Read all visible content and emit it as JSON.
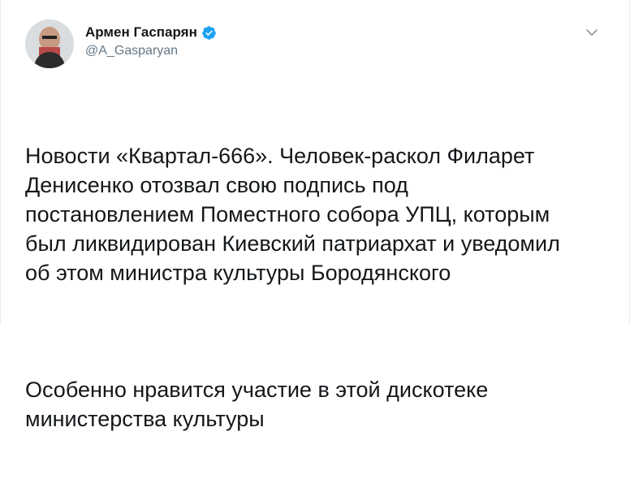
{
  "author": {
    "display_name": "Армен Гаспарян",
    "handle": "@A_Gasparyan",
    "verified": true,
    "avatar_icon": "user-avatar"
  },
  "menu": {
    "icon": "chevron-down-icon"
  },
  "tweet": {
    "paragraph_1": "Новости «Квартал-666». Человек-раскол Филарет\nДенисенко отозвал свою подпись под\nпостановлением Поместного собора УПЦ, которым\nбыл ликвидирован Киевский патриархат и уведомил\nоб этом министра культуры Бородянского",
    "paragraph_2": "Особенно нравится участие в этой дискотеке\nминистерства культуры"
  },
  "colors": {
    "text": "#14171a",
    "secondary": "#657786",
    "verified_blue": "#1da1f2",
    "border": "#e6ecf0"
  }
}
